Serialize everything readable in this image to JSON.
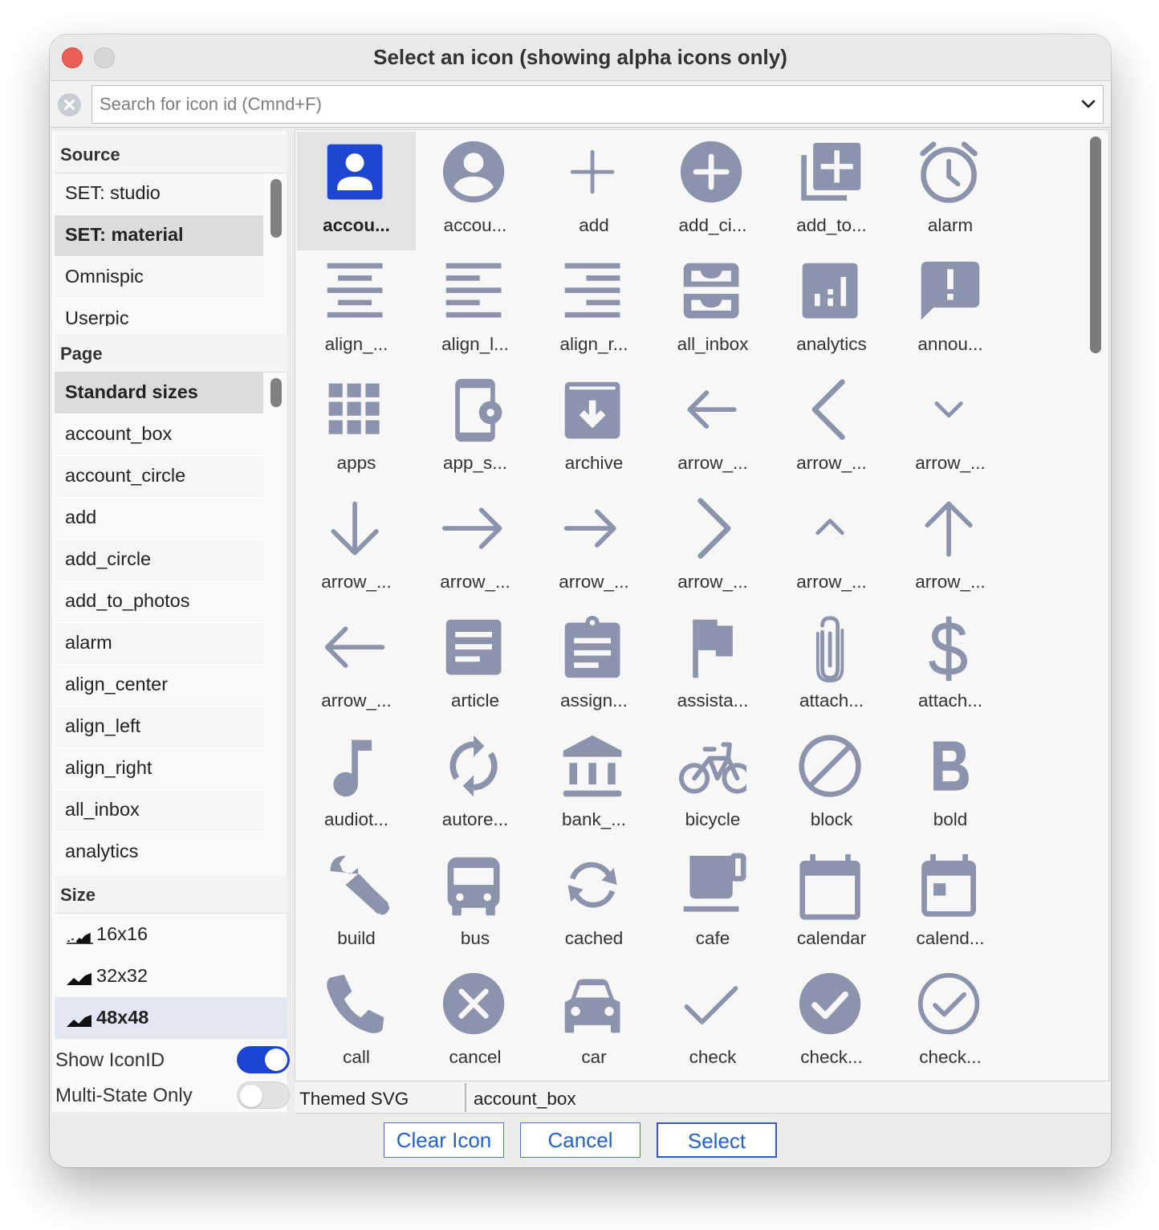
{
  "window": {
    "title": "Select an icon (showing alpha icons only)"
  },
  "search": {
    "placeholder": "Search for icon id (Cmnd+F)"
  },
  "source": {
    "header": "Source",
    "items": [
      {
        "label": "SET: studio",
        "selected": false
      },
      {
        "label": "SET: material",
        "selected": true
      },
      {
        "label": "Omnispic",
        "selected": false
      },
      {
        "label": "Userpic",
        "selected": false
      }
    ]
  },
  "page": {
    "header": "Page",
    "items": [
      {
        "label": "Standard sizes",
        "selected": true
      },
      {
        "label": "account_box",
        "selected": false
      },
      {
        "label": "account_circle",
        "selected": false
      },
      {
        "label": "add",
        "selected": false
      },
      {
        "label": "add_circle",
        "selected": false
      },
      {
        "label": "add_to_photos",
        "selected": false
      },
      {
        "label": "alarm",
        "selected": false
      },
      {
        "label": "align_center",
        "selected": false
      },
      {
        "label": "align_left",
        "selected": false
      },
      {
        "label": "align_right",
        "selected": false
      },
      {
        "label": "all_inbox",
        "selected": false
      },
      {
        "label": "analytics",
        "selected": false
      }
    ]
  },
  "size": {
    "header": "Size",
    "items": [
      {
        "label": "16x16",
        "selected": false
      },
      {
        "label": "32x32",
        "selected": false
      },
      {
        "label": "48x48",
        "selected": true
      }
    ]
  },
  "toggles": {
    "show_iconid": {
      "label": "Show IconID",
      "on": true
    },
    "multi_state": {
      "label": "Multi-State Only",
      "on": false
    }
  },
  "colors": {
    "icon": "#8b93ad",
    "selected_icon": "#1d47d2",
    "toggle_on": "#1b46d4",
    "button_text": "#2462c8"
  },
  "icons": [
    {
      "name": "account-box-icon",
      "caption": "accou...",
      "selected": true
    },
    {
      "name": "account-circle-icon",
      "caption": "accou..."
    },
    {
      "name": "add-icon",
      "caption": "add"
    },
    {
      "name": "add-circle-icon",
      "caption": "add_ci..."
    },
    {
      "name": "add-to-photos-icon",
      "caption": "add_to..."
    },
    {
      "name": "alarm-icon",
      "caption": "alarm"
    },
    {
      "name": "align-center-icon",
      "caption": "align_..."
    },
    {
      "name": "align-left-icon",
      "caption": "align_l..."
    },
    {
      "name": "align-right-icon",
      "caption": "align_r..."
    },
    {
      "name": "all-inbox-icon",
      "caption": "all_inbox"
    },
    {
      "name": "analytics-icon",
      "caption": "analytics"
    },
    {
      "name": "announcement-icon",
      "caption": "annou..."
    },
    {
      "name": "apps-icon",
      "caption": "apps"
    },
    {
      "name": "app-settings-icon",
      "caption": "app_s..."
    },
    {
      "name": "archive-icon",
      "caption": "archive"
    },
    {
      "name": "arrow-back-icon",
      "caption": "arrow_..."
    },
    {
      "name": "arrow-back-ios-icon",
      "caption": "arrow_..."
    },
    {
      "name": "arrow-drop-down-icon",
      "caption": "arrow_..."
    },
    {
      "name": "arrow-downward-icon",
      "caption": "arrow_..."
    },
    {
      "name": "arrow-forward-icon",
      "caption": "arrow_..."
    },
    {
      "name": "arrow-right-alt-icon",
      "caption": "arrow_..."
    },
    {
      "name": "arrow-forward-ios-icon",
      "caption": "arrow_..."
    },
    {
      "name": "arrow-drop-up-icon",
      "caption": "arrow_..."
    },
    {
      "name": "arrow-upward-icon",
      "caption": "arrow_..."
    },
    {
      "name": "arrow-left-alt-icon",
      "caption": "arrow_..."
    },
    {
      "name": "article-icon",
      "caption": "article"
    },
    {
      "name": "assignment-icon",
      "caption": "assign..."
    },
    {
      "name": "assistant-flag-icon",
      "caption": "assista..."
    },
    {
      "name": "attach-file-icon",
      "caption": "attach..."
    },
    {
      "name": "attach-money-icon",
      "caption": "attach..."
    },
    {
      "name": "audiotrack-icon",
      "caption": "audiot..."
    },
    {
      "name": "autorenew-icon",
      "caption": "autore..."
    },
    {
      "name": "bank-icon",
      "caption": "bank_..."
    },
    {
      "name": "bicycle-icon",
      "caption": "bicycle"
    },
    {
      "name": "block-icon",
      "caption": "block"
    },
    {
      "name": "bold-icon",
      "caption": "bold"
    },
    {
      "name": "build-icon",
      "caption": "build"
    },
    {
      "name": "bus-icon",
      "caption": "bus"
    },
    {
      "name": "cached-icon",
      "caption": "cached"
    },
    {
      "name": "cafe-icon",
      "caption": "cafe"
    },
    {
      "name": "calendar-icon",
      "caption": "calendar"
    },
    {
      "name": "calendar-today-icon",
      "caption": "calend..."
    },
    {
      "name": "call-icon",
      "caption": "call"
    },
    {
      "name": "cancel-icon",
      "caption": "cancel"
    },
    {
      "name": "car-icon",
      "caption": "car"
    },
    {
      "name": "check-icon",
      "caption": "check"
    },
    {
      "name": "check-circle-icon",
      "caption": "check..."
    },
    {
      "name": "check-circle-outline-icon",
      "caption": "check..."
    }
  ],
  "status": {
    "type": "Themed SVG",
    "icon_id": "account_box"
  },
  "buttons": {
    "clear": "Clear Icon",
    "cancel": "Cancel",
    "select": "Select"
  }
}
